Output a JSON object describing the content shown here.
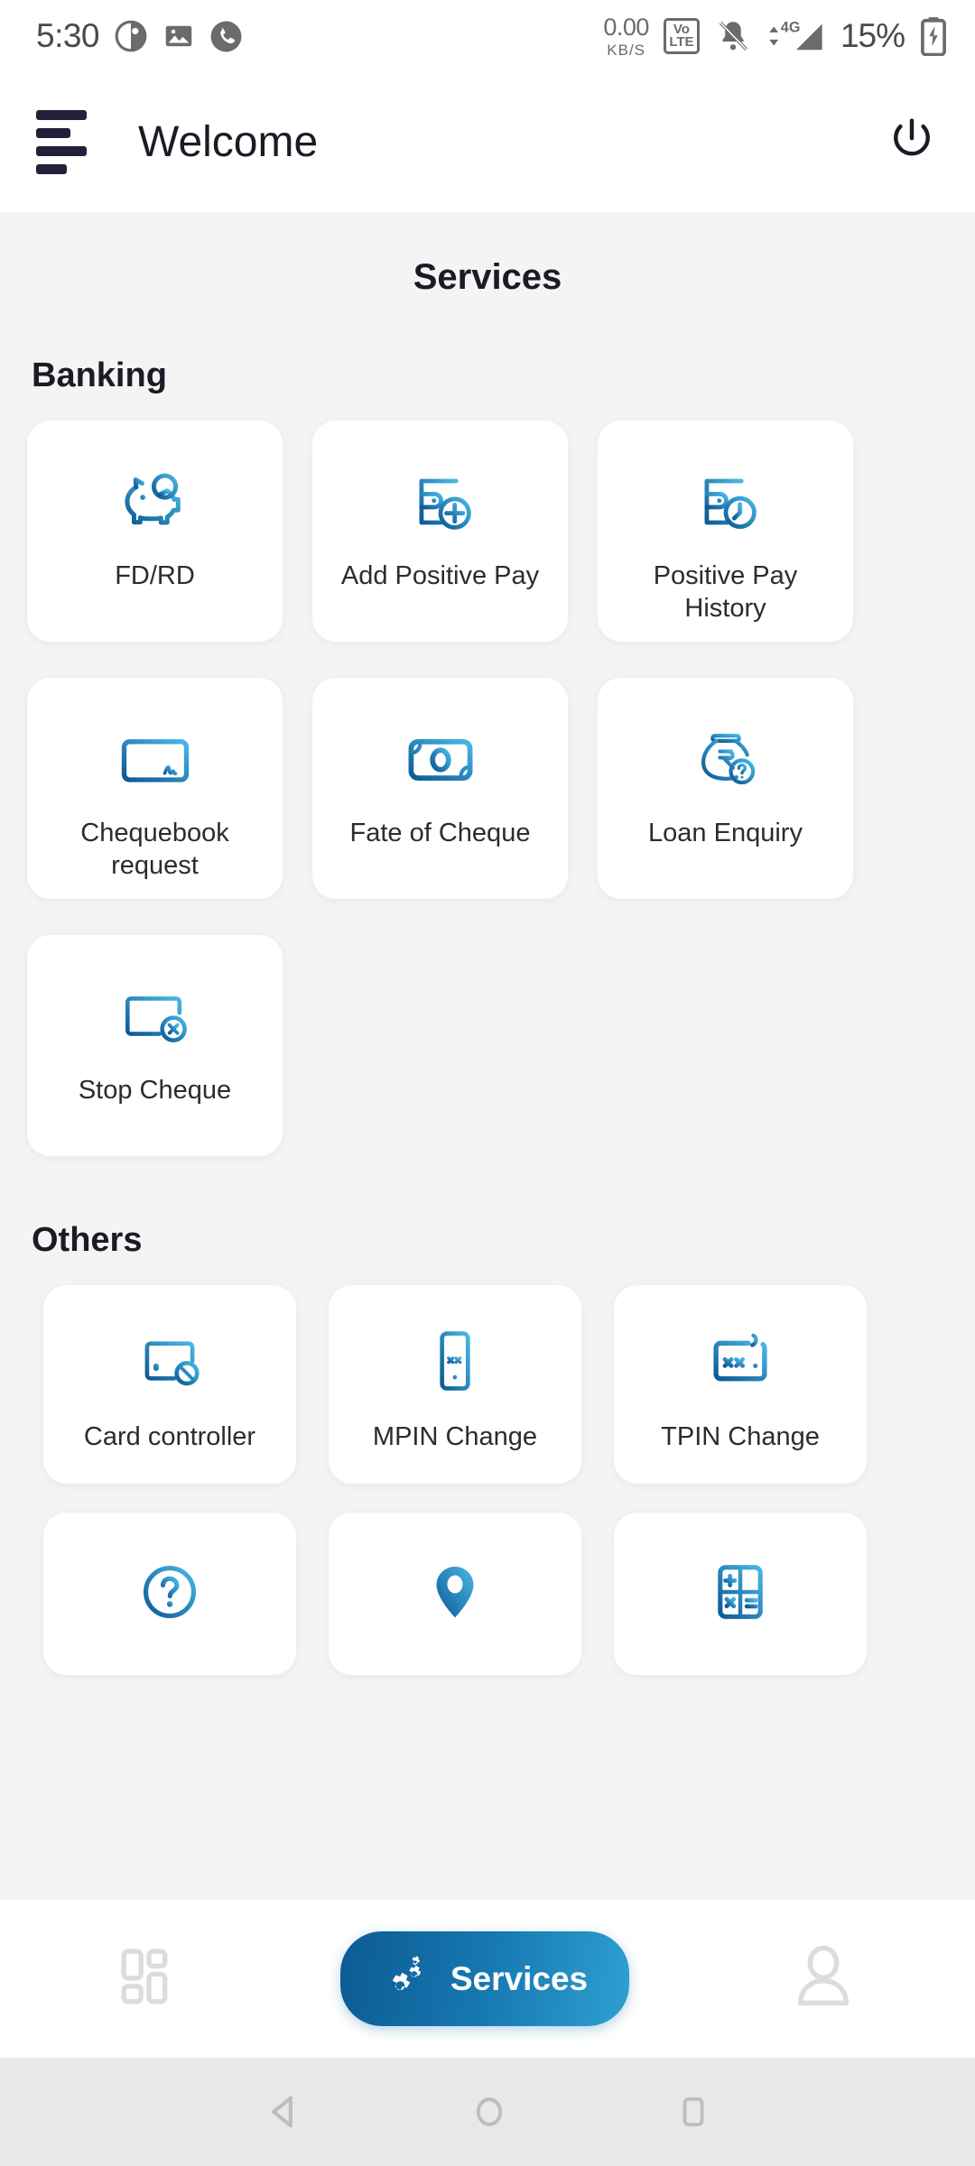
{
  "statusbar": {
    "time": "5:30",
    "icons_left": [
      "app-notification-icon",
      "gallery-icon",
      "phone-call-icon"
    ],
    "data_rate": "0.00",
    "data_unit": "KB/S",
    "volte_top": "Vo",
    "volte_bottom": "LTE",
    "network": "4G",
    "battery_percent": "15%",
    "mute_icon": "bell-muted-icon",
    "battery_icon": "battery-charging-icon"
  },
  "appbar": {
    "menu_icon": "hamburger-menu-icon",
    "title": "Welcome",
    "power_icon": "power-icon"
  },
  "page": {
    "title": "Services"
  },
  "sections": [
    {
      "id": "banking",
      "title": "Banking",
      "items": [
        {
          "label": "FD/RD",
          "icon": "piggy-bank-icon"
        },
        {
          "label": "Add Positive Pay",
          "icon": "wallet-plus-icon"
        },
        {
          "label": "Positive Pay History",
          "icon": "wallet-clock-icon"
        },
        {
          "label": "Chequebook request",
          "icon": "cheque-signature-icon"
        },
        {
          "label": "Fate of Cheque",
          "icon": "banknote-icon"
        },
        {
          "label": "Loan Enquiry",
          "icon": "money-bag-question-icon"
        },
        {
          "label": "Stop Cheque",
          "icon": "cheque-cancel-icon"
        }
      ]
    },
    {
      "id": "others",
      "title": "Others",
      "items": [
        {
          "label": "Card controller",
          "icon": "card-blocked-icon"
        },
        {
          "label": "MPIN Change",
          "icon": "mobile-pin-icon"
        },
        {
          "label": "TPIN Change",
          "icon": "telephone-pin-icon"
        },
        {
          "label": "",
          "icon": "help-question-icon"
        },
        {
          "label": "",
          "icon": "location-pin-icon"
        },
        {
          "label": "",
          "icon": "calculator-icon"
        }
      ]
    }
  ],
  "bottomnav": {
    "items": [
      {
        "label": "",
        "icon": "dashboard-grid-icon",
        "active": false
      },
      {
        "label": "Services",
        "icon": "gears-icon",
        "active": true
      },
      {
        "label": "",
        "icon": "profile-person-icon",
        "active": false
      }
    ]
  },
  "androidnav": {
    "back": "back-triangle-icon",
    "home": "home-circle-icon",
    "recents": "recents-square-icon"
  },
  "colors": {
    "accent_dark": "#0d5a94",
    "accent_light": "#2ea0d2",
    "page_bg": "#f4f4f4",
    "card_bg": "#ffffff",
    "text": "#1b1b25",
    "muted": "#dcdcdc"
  }
}
